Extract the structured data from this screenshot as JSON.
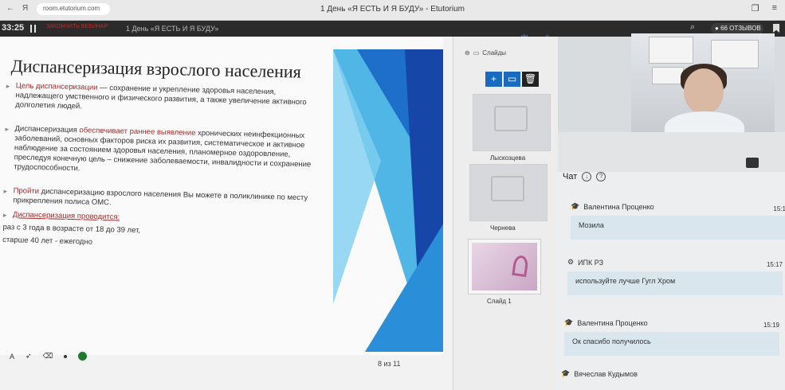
{
  "browser": {
    "url": "room.etutorium.com",
    "tab_title": "1 День «Я ЕСТЬ И Я БУДУ» - Etutorium",
    "nav_letter": "Я"
  },
  "app_header": {
    "timer": "33:25",
    "end_button": "ЗАКОНЧИТЬ ВЕБИНАР",
    "webinar_title": "1 День «Я ЕСТЬ И Я БУДУ»",
    "reviews_label": "66 ОТЗЫВОВ"
  },
  "slide": {
    "title": "Диспансеризация взрослого населения",
    "b1_red": "Цель диспансеризации",
    "b1_rest": " — сохранение и укрепление здоровья населения, надлежащего умственного и физического развития, а также увеличение активного долголетия людей.",
    "b2_pre": "Диспансеризация ",
    "b2_red": "обеспечивает раннее выявление",
    "b2_rest": " хронических неинфекционных заболеваний, основных факторов риска их развития, систематическое и активное наблюдение за состоянием здоровья населения, планомерное оздоровление, преследуя конечную цель – снижение заболеваемости, инвалидности и сохранение трудоспособности.",
    "b3_red": "Пройти",
    "b3_rest": " диспансеризацию взрослого населения Вы можете в поликлинике по месту прикрепления полиса ОМС.",
    "b4": "Диспансеризация проводится:",
    "line1": "раз с 3 года в возрасте от 18 до 39 лет,",
    "line2": "старше 40 лет - ежегодно",
    "page_counter": "8 из 11"
  },
  "slides_panel": {
    "header": "Слайды",
    "folder1": "Лыскозцева",
    "folder2": "Чернева",
    "slide1": "Слайд 1"
  },
  "chat": {
    "title": "Чат",
    "messages": [
      {
        "author": "Валентина Проценко",
        "time": "15:1",
        "text": "Мозила"
      },
      {
        "author": "ИПК РЗ",
        "time": "15:17",
        "text": "используйте лучше Гугл Хром"
      },
      {
        "author": "Валентина Проценко",
        "time": "15:19",
        "text": "Ок спасибо получилось"
      },
      {
        "author": "Вячеслав Кудымов",
        "time": "",
        "text": ""
      }
    ]
  },
  "colors": {
    "accent_blue": "#1a6bc0",
    "header_dark": "#2b2b2b",
    "text_red": "#a52a2a"
  }
}
